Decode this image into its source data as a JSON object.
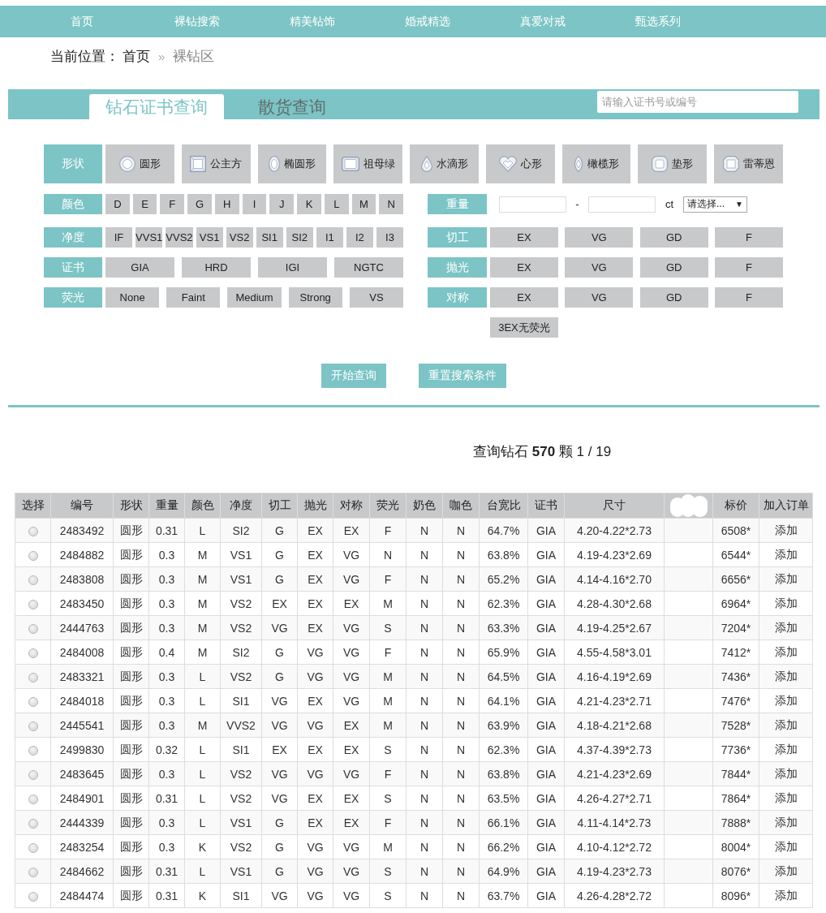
{
  "nav": {
    "items": [
      "首页",
      "裸钻搜索",
      "精美钻饰",
      "婚戒精选",
      "真爱对戒",
      "甄选系列"
    ]
  },
  "breadcrumb": {
    "label": "当前位置：",
    "separator": "»",
    "items": [
      {
        "label": "首页",
        "current": false
      },
      {
        "label": "裸钻区",
        "current": true
      }
    ]
  },
  "search_panel": {
    "tabs": [
      {
        "label": "钻石证书查询",
        "selected": true
      },
      {
        "label": "散货查询",
        "selected": false
      }
    ],
    "search": {
      "placeholder": "请输入证书号或编号"
    }
  },
  "filters": {
    "shape": {
      "label": "形状",
      "options": [
        {
          "label": "圆形",
          "kind": "round"
        },
        {
          "label": "公主方",
          "kind": "princess"
        },
        {
          "label": "椭圆形",
          "kind": "oval"
        },
        {
          "label": "祖母绿",
          "kind": "emerald"
        },
        {
          "label": "水滴形",
          "kind": "pear"
        },
        {
          "label": "心形",
          "kind": "heart"
        },
        {
          "label": "橄榄形",
          "kind": "marquise"
        },
        {
          "label": "垫形",
          "kind": "cushion"
        },
        {
          "label": "雷蒂恩",
          "kind": "radiant"
        }
      ]
    },
    "left_column": [
      {
        "label": "颜色",
        "kind": "options",
        "options": [
          "D",
          "E",
          "F",
          "G",
          "H",
          "I",
          "J",
          "K",
          "L",
          "M",
          "N"
        ]
      },
      {
        "label": "净度",
        "kind": "options",
        "options": [
          "IF",
          "VVS1",
          "VVS2",
          "VS1",
          "VS2",
          "SI1",
          "SI2",
          "I1",
          "I2",
          "I3"
        ]
      },
      {
        "label": "证书",
        "kind": "options",
        "options": [
          "GIA",
          "HRD",
          "IGI",
          "NGTC"
        ]
      },
      {
        "label": "荧光",
        "kind": "options",
        "options": [
          "None",
          "Faint",
          "Medium",
          "Strong",
          "VS"
        ]
      }
    ],
    "right_column": [
      {
        "label": "重量",
        "kind": "range",
        "separator": "-",
        "unit": "ct",
        "select": {
          "value": "请选择...",
          "caret": "▼"
        }
      },
      {
        "label": "切工",
        "kind": "options",
        "options": [
          "EX",
          "VG",
          "GD",
          "F"
        ]
      },
      {
        "label": "抛光",
        "kind": "options",
        "options": [
          "EX",
          "VG",
          "GD",
          "F"
        ]
      },
      {
        "label": "对称",
        "kind": "options",
        "options": [
          "EX",
          "VG",
          "GD",
          "F"
        ]
      },
      {
        "kind": "options",
        "options": [
          "3EX无荧光"
        ]
      }
    ]
  },
  "actions": [
    "开始查询",
    "重置搜索条件"
  ],
  "results": {
    "summary": "查询钻石 **570** 颗 1 / 19"
  },
  "table": {
    "columns": [
      {
        "label": "选择",
        "kind": "radio"
      },
      {
        "label": "编号",
        "kind": "text"
      },
      {
        "label": "形状",
        "kind": "text"
      },
      {
        "label": "重量",
        "kind": "text"
      },
      {
        "label": "颜色",
        "kind": "text"
      },
      {
        "label": "净度",
        "kind": "text"
      },
      {
        "label": "切工",
        "kind": "text"
      },
      {
        "label": "抛光",
        "kind": "text"
      },
      {
        "label": "对称",
        "kind": "text"
      },
      {
        "label": "荧光",
        "kind": "text"
      },
      {
        "label": "奶色",
        "kind": "text"
      },
      {
        "label": "咖色",
        "kind": "text"
      },
      {
        "label": "台宽比",
        "kind": "text"
      },
      {
        "label": "证书",
        "kind": "text"
      },
      {
        "label": "尺寸",
        "kind": "text"
      },
      {
        "kind": "redacted"
      },
      {
        "label": "标价",
        "kind": "text"
      },
      {
        "label": "加入订单",
        "kind": "link"
      }
    ],
    "rows": [
      {
        "selected": false,
        "cells": [
          "",
          "2483492",
          "圆形",
          "0.31",
          "L",
          "SI2",
          "G",
          "EX",
          "EX",
          "F",
          "N",
          "N",
          "64.7%",
          "GIA",
          "4.20-4.22*2.73",
          "",
          "6508*",
          "添加"
        ]
      },
      {
        "selected": false,
        "cells": [
          "",
          "2484882",
          "圆形",
          "0.3",
          "M",
          "VS1",
          "G",
          "EX",
          "VG",
          "N",
          "N",
          "N",
          "63.8%",
          "GIA",
          "4.19-4.23*2.69",
          "",
          "6544*",
          "添加"
        ]
      },
      {
        "selected": false,
        "cells": [
          "",
          "2483808",
          "圆形",
          "0.3",
          "M",
          "VS1",
          "G",
          "EX",
          "VG",
          "F",
          "N",
          "N",
          "65.2%",
          "GIA",
          "4.14-4.16*2.70",
          "",
          "6656*",
          "添加"
        ]
      },
      {
        "selected": false,
        "cells": [
          "",
          "2483450",
          "圆形",
          "0.3",
          "M",
          "VS2",
          "EX",
          "EX",
          "EX",
          "M",
          "N",
          "N",
          "62.3%",
          "GIA",
          "4.28-4.30*2.68",
          "",
          "6964*",
          "添加"
        ]
      },
      {
        "selected": false,
        "cells": [
          "",
          "2444763",
          "圆形",
          "0.3",
          "M",
          "VS2",
          "VG",
          "EX",
          "VG",
          "S",
          "N",
          "N",
          "63.3%",
          "GIA",
          "4.19-4.25*2.67",
          "",
          "7204*",
          "添加"
        ]
      },
      {
        "selected": false,
        "cells": [
          "",
          "2484008",
          "圆形",
          "0.4",
          "M",
          "SI2",
          "G",
          "VG",
          "VG",
          "F",
          "N",
          "N",
          "65.9%",
          "GIA",
          "4.55-4.58*3.01",
          "",
          "7412*",
          "添加"
        ]
      },
      {
        "selected": false,
        "cells": [
          "",
          "2483321",
          "圆形",
          "0.3",
          "L",
          "VS2",
          "G",
          "VG",
          "VG",
          "M",
          "N",
          "N",
          "64.5%",
          "GIA",
          "4.16-4.19*2.69",
          "",
          "7436*",
          "添加"
        ]
      },
      {
        "selected": false,
        "cells": [
          "",
          "2484018",
          "圆形",
          "0.3",
          "L",
          "SI1",
          "VG",
          "EX",
          "VG",
          "M",
          "N",
          "N",
          "64.1%",
          "GIA",
          "4.21-4.23*2.71",
          "",
          "7476*",
          "添加"
        ]
      },
      {
        "selected": false,
        "cells": [
          "",
          "2445541",
          "圆形",
          "0.3",
          "M",
          "VVS2",
          "VG",
          "VG",
          "EX",
          "M",
          "N",
          "N",
          "63.9%",
          "GIA",
          "4.18-4.21*2.68",
          "",
          "7528*",
          "添加"
        ]
      },
      {
        "selected": false,
        "cells": [
          "",
          "2499830",
          "圆形",
          "0.32",
          "L",
          "SI1",
          "EX",
          "EX",
          "EX",
          "S",
          "N",
          "N",
          "62.3%",
          "GIA",
          "4.37-4.39*2.73",
          "",
          "7736*",
          "添加"
        ]
      },
      {
        "selected": false,
        "cells": [
          "",
          "2483645",
          "圆形",
          "0.3",
          "L",
          "VS2",
          "VG",
          "VG",
          "VG",
          "F",
          "N",
          "N",
          "63.8%",
          "GIA",
          "4.21-4.23*2.69",
          "",
          "7844*",
          "添加"
        ]
      },
      {
        "selected": false,
        "cells": [
          "",
          "2484901",
          "圆形",
          "0.31",
          "L",
          "VS2",
          "VG",
          "EX",
          "EX",
          "S",
          "N",
          "N",
          "63.5%",
          "GIA",
          "4.26-4.27*2.71",
          "",
          "7864*",
          "添加"
        ]
      },
      {
        "selected": false,
        "cells": [
          "",
          "2444339",
          "圆形",
          "0.3",
          "L",
          "VS1",
          "G",
          "EX",
          "EX",
          "F",
          "N",
          "N",
          "66.1%",
          "GIA",
          "4.11-4.14*2.73",
          "",
          "7888*",
          "添加"
        ]
      },
      {
        "selected": false,
        "cells": [
          "",
          "2483254",
          "圆形",
          "0.3",
          "K",
          "VS2",
          "G",
          "VG",
          "VG",
          "M",
          "N",
          "N",
          "66.2%",
          "GIA",
          "4.10-4.12*2.72",
          "",
          "8004*",
          "添加"
        ]
      },
      {
        "selected": false,
        "cells": [
          "",
          "2484662",
          "圆形",
          "0.31",
          "L",
          "VS1",
          "G",
          "VG",
          "VG",
          "S",
          "N",
          "N",
          "64.9%",
          "GIA",
          "4.19-4.23*2.73",
          "",
          "8076*",
          "添加"
        ]
      },
      {
        "selected": false,
        "cells": [
          "",
          "2484474",
          "圆形",
          "0.31",
          "K",
          "SI1",
          "VG",
          "VG",
          "VG",
          "S",
          "N",
          "N",
          "63.7%",
          "GIA",
          "4.26-4.28*2.72",
          "",
          "8096*",
          "添加"
        ]
      }
    ]
  }
}
